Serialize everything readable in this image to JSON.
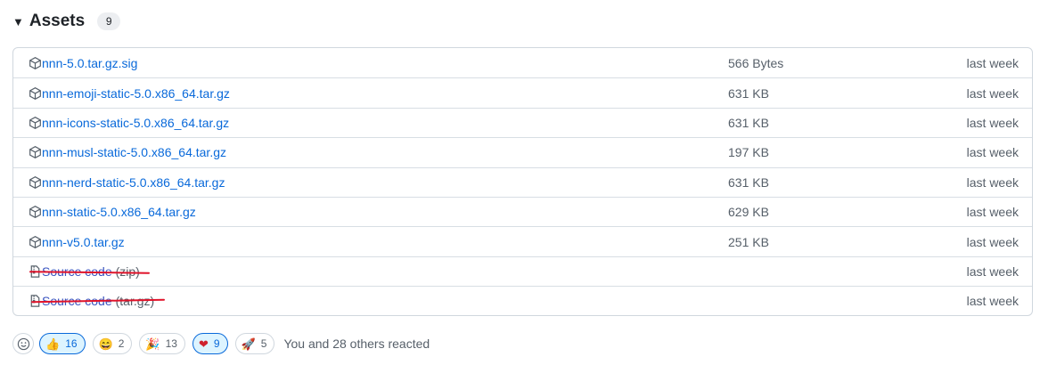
{
  "header": {
    "title": "Assets",
    "count": "9"
  },
  "assets": [
    {
      "name": "nnn-5.0.tar.gz.sig",
      "size": "566 Bytes",
      "date": "last week",
      "icon": "package-icon"
    },
    {
      "name": "nnn-emoji-static-5.0.x86_64.tar.gz",
      "size": "631 KB",
      "date": "last week",
      "icon": "package-icon"
    },
    {
      "name": "nnn-icons-static-5.0.x86_64.tar.gz",
      "size": "631 KB",
      "date": "last week",
      "icon": "package-icon"
    },
    {
      "name": "nnn-musl-static-5.0.x86_64.tar.gz",
      "size": "197 KB",
      "date": "last week",
      "icon": "package-icon"
    },
    {
      "name": "nnn-nerd-static-5.0.x86_64.tar.gz",
      "size": "631 KB",
      "date": "last week",
      "icon": "package-icon"
    },
    {
      "name": "nnn-static-5.0.x86_64.tar.gz",
      "size": "629 KB",
      "date": "last week",
      "icon": "package-icon"
    },
    {
      "name": "nnn-v5.0.tar.gz",
      "size": "251 KB",
      "date": "last week",
      "icon": "package-icon"
    },
    {
      "name": "Source code",
      "suffix": "(zip)",
      "size": "",
      "date": "last week",
      "icon": "file-zip-icon"
    },
    {
      "name": "Source code",
      "suffix": "(tar.gz)",
      "size": "",
      "date": "last week",
      "icon": "file-zip-icon"
    }
  ],
  "reactions": {
    "items": [
      {
        "emoji": "👍",
        "count": "16",
        "active": true,
        "icon": "thumbs-up-icon"
      },
      {
        "emoji": "😄",
        "count": "2",
        "active": false,
        "icon": "laugh-icon"
      },
      {
        "emoji": "🎉",
        "count": "13",
        "active": false,
        "icon": "hooray-icon"
      },
      {
        "emoji": "❤",
        "count": "9",
        "active": true,
        "icon": "heart-icon"
      },
      {
        "emoji": "🚀",
        "count": "5",
        "active": false,
        "icon": "rocket-icon"
      }
    ],
    "summary": "You and 28 others reacted"
  },
  "colors": {
    "link": "#0969da",
    "strike": "#e0132a",
    "border": "#d0d7de"
  }
}
